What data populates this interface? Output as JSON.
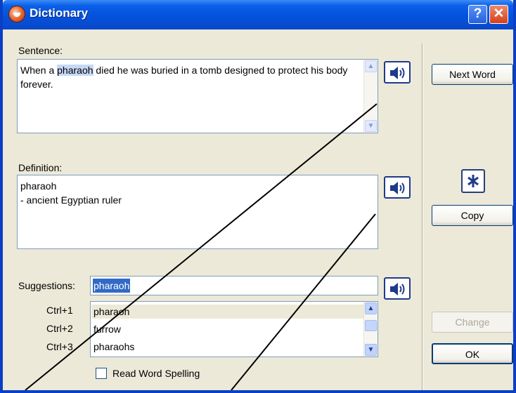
{
  "window": {
    "title": "Dictionary"
  },
  "sentence": {
    "label": "Sentence:",
    "text_before": "When a ",
    "highlight": "pharaoh",
    "text_after": " died he was buried in a tomb designed to protect his body forever."
  },
  "definition": {
    "label": "Definition:",
    "line1": "pharaoh",
    "line2": "- ancient Egyptian ruler"
  },
  "suggestions": {
    "label": "Suggestions:",
    "value": "pharaoh",
    "items": [
      {
        "shortcut": "Ctrl+1",
        "word": "pharaoh"
      },
      {
        "shortcut": "Ctrl+2",
        "word": "furrow"
      },
      {
        "shortcut": "Ctrl+3",
        "word": "pharaohs"
      }
    ]
  },
  "read_spelling": {
    "label": "Read Word Spelling",
    "checked": false
  },
  "buttons": {
    "next_word": "Next Word",
    "copy": "Copy",
    "change": "Change",
    "ok": "OK"
  },
  "icons": {
    "app": "dictionary-app-icon",
    "speaker": "speaker-icon",
    "help": "help-icon",
    "close": "close-icon"
  },
  "colors": {
    "titlebar": "#0A5FE8",
    "selection": "#316AC5",
    "dialog": "#ECE9D8"
  }
}
